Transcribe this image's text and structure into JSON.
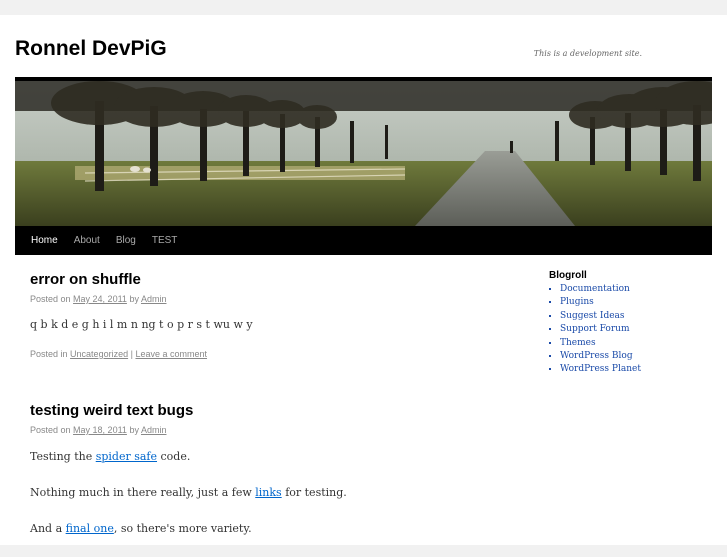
{
  "site": {
    "title": "Ronnel DevPiG",
    "description": "This is a development site."
  },
  "nav": {
    "items": [
      {
        "label": "Home",
        "current": true
      },
      {
        "label": "About"
      },
      {
        "label": "Blog"
      },
      {
        "label": "TEST"
      }
    ]
  },
  "posts": [
    {
      "title": "error on shuffle",
      "meta_prefix": "Posted on",
      "date": "May 24, 2011",
      "by": "by",
      "author": "Admin",
      "body": "q b k d e g h i l m n ng t o p r s t wu w y",
      "utility_prefix": "Posted in",
      "category": "Uncategorized",
      "separator": "|",
      "comment_link": "Leave a comment"
    },
    {
      "title": "testing weird text bugs",
      "meta_prefix": "Posted on",
      "date": "May 18, 2011",
      "by": "by",
      "author": "Admin",
      "p1_before": "Testing the",
      "p1_link": "spider safe",
      "p1_after": "code.",
      "p2_before": "Nothing much in there really, just a few",
      "p2_link": "links",
      "p2_after": "for testing.",
      "p3_before": "And a",
      "p3_link": "final one",
      "p3_after": ", so there's more variety."
    }
  ],
  "sidebar": {
    "widget_title": "Blogroll",
    "links": [
      "Documentation",
      "Plugins",
      "Suggest Ideas",
      "Support Forum",
      "Themes",
      "WordPress Blog",
      "WordPress Planet"
    ]
  },
  "colors": {
    "background": "#f1f1f1",
    "nav_bar": "#000000",
    "link": "#0066cc",
    "sidebar_link": "#1a4aa8"
  }
}
